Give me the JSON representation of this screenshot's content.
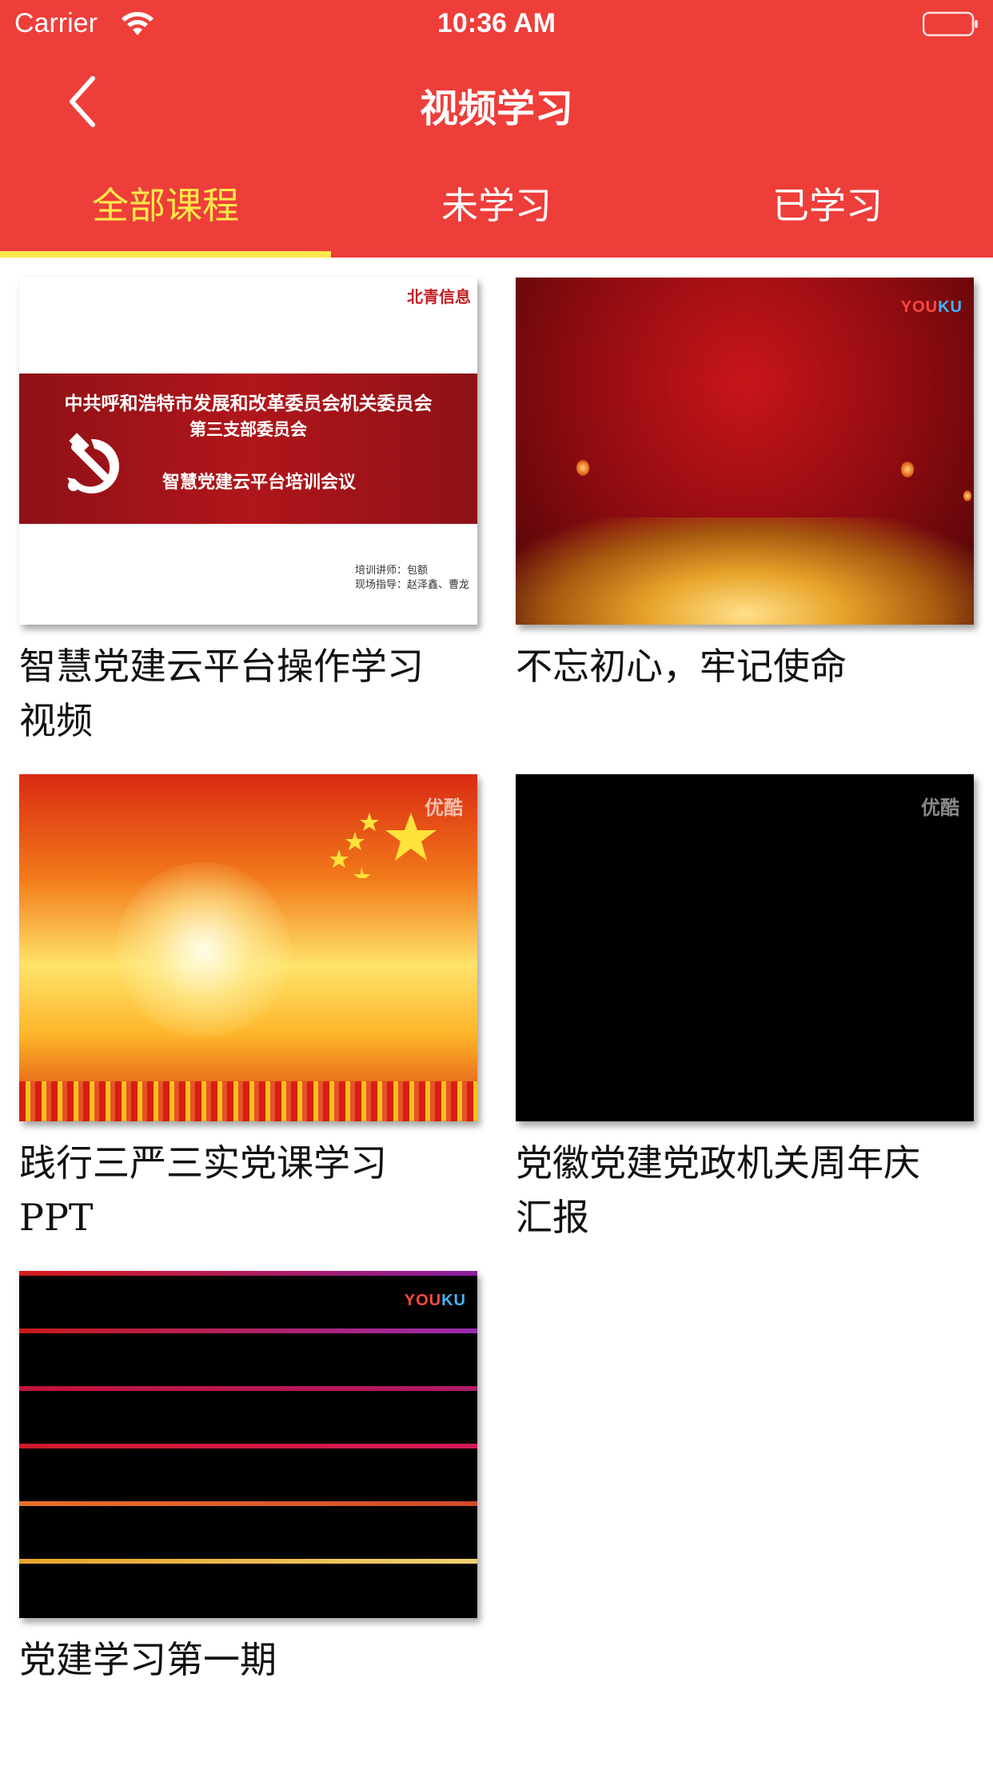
{
  "status_bar": {
    "carrier": "Carrier",
    "time": "10:36 AM"
  },
  "nav": {
    "title": "视频学习",
    "back_icon": "chevron-left-icon"
  },
  "tabs": [
    {
      "label": "全部课程",
      "active": true
    },
    {
      "label": "未学习",
      "active": false
    },
    {
      "label": "已学习",
      "active": false
    }
  ],
  "colors": {
    "header_bg": "#EE3E3A",
    "active_tab": "#FFE94A",
    "text": "#111111"
  },
  "courses": [
    {
      "title": "智慧党建云平台操作学习视频",
      "thumbnail": {
        "brand": "北青信息",
        "line1": "中共呼和浩特市发展和改革委员会机关委员会",
        "line2": "第三支部委员会",
        "line3": "智慧党建云平台培训会议",
        "credit1": "培训讲师：包额",
        "credit2": "现场指导：赵泽鑫、曹龙"
      }
    },
    {
      "title": "不忘初心，牢记使命",
      "thumbnail": {
        "logo_a": "YOU",
        "logo_b": "KU"
      }
    },
    {
      "title": "践行三严三实党课学习PPT",
      "thumbnail": {
        "logo": "优酷"
      }
    },
    {
      "title": "党徽党建党政机关周年庆汇报",
      "thumbnail": {
        "logo": "优酷"
      }
    },
    {
      "title": "党建学习第一期",
      "thumbnail": {
        "logo_a": "YOU",
        "logo_b": "KU"
      }
    }
  ]
}
